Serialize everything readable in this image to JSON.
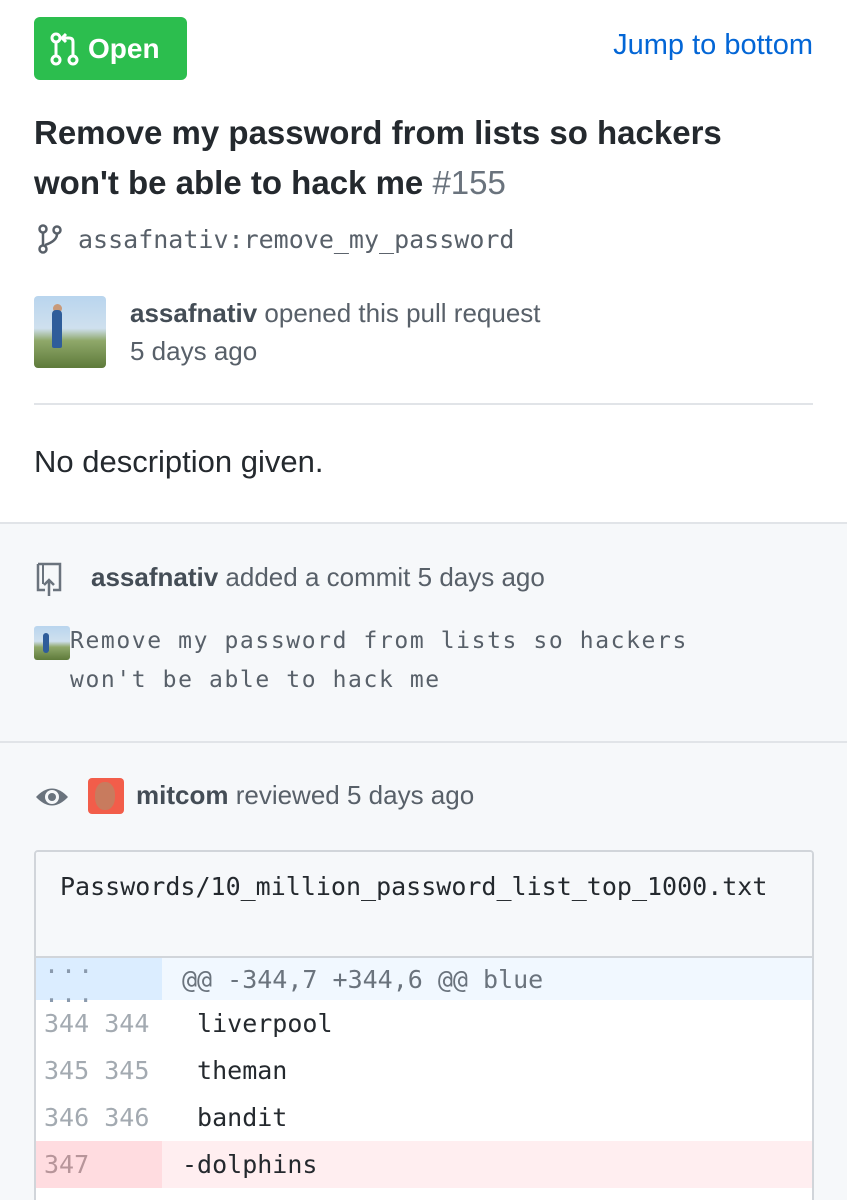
{
  "header": {
    "status_label": "Open",
    "jump_link": "Jump to bottom"
  },
  "pr": {
    "title": "Remove my password from lists so hackers won't be able to hack me",
    "number": "#155",
    "branch": "assafnativ:remove_my_password",
    "author": "assafnativ",
    "opened_text": "opened this pull request",
    "opened_time": "5 days ago",
    "description": "No description given."
  },
  "commit_event": {
    "author": "assafnativ",
    "action": "added a commit 5 days ago",
    "message_line1": "Remove my password from lists so hackers",
    "message_line2": "won't be able to hack me"
  },
  "review_event": {
    "reviewer": "mitcom",
    "action": "reviewed 5 days ago"
  },
  "diff": {
    "file_path": "Passwords/10_million_password_list_top_1000.txt",
    "hunk_nums": "... ...",
    "hunk_header": "@@ -344,7 +344,6 @@ blue",
    "rows": [
      {
        "old": "344",
        "new": "344",
        "code": " liverpool"
      },
      {
        "old": "345",
        "new": "345",
        "code": " theman"
      },
      {
        "old": "346",
        "new": "346",
        "code": " bandit"
      },
      {
        "old": "347",
        "new": "",
        "code": "-dolphins"
      }
    ]
  },
  "colors": {
    "open_green": "#2cbe4e",
    "link_blue": "#0366d6",
    "deleted_row": "#ffeef0",
    "hunk_row": "#f1f8ff"
  },
  "icons": [
    "git-pull-request-icon",
    "git-branch-icon",
    "repo-push-icon",
    "eye-icon"
  ]
}
